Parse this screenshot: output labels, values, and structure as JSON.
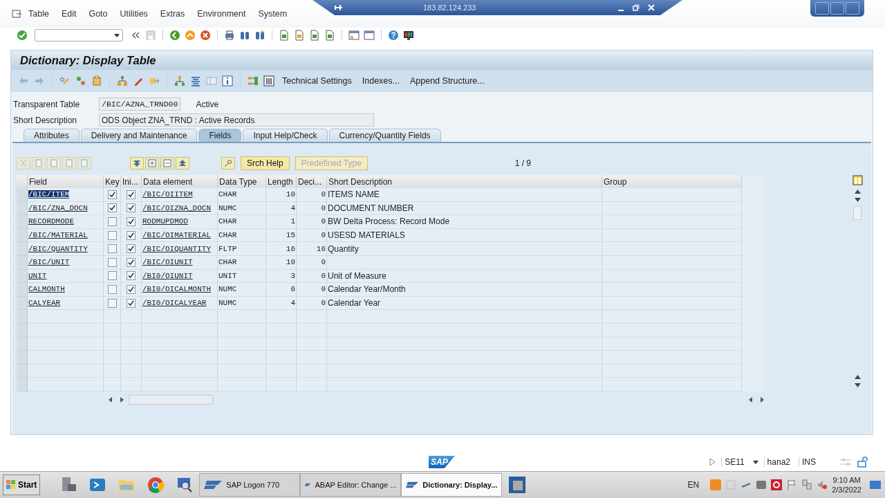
{
  "remote_bar": {
    "title": "183.82.124.233"
  },
  "menu": [
    "Table",
    "Edit",
    "Goto",
    "Utilities",
    "Extras",
    "Environment",
    "System"
  ],
  "screen_title": "Dictionary: Display Table",
  "app_toolbar": [
    "Technical Settings",
    "Indexes...",
    "Append Structure..."
  ],
  "header": {
    "type_label": "Transparent Table",
    "table_name": "/BIC/AZNA_TRND00",
    "status": "Active",
    "desc_label": "Short Description",
    "description": "ODS Object ZNA_TRND : Active Records"
  },
  "tabs": [
    {
      "label": "Attributes",
      "selected": false
    },
    {
      "label": "Delivery and Maintenance",
      "selected": false
    },
    {
      "label": "Fields",
      "selected": true
    },
    {
      "label": "Input Help/Check",
      "selected": false
    },
    {
      "label": "Currency/Quantity Fields",
      "selected": false
    }
  ],
  "table_buttons": [
    {
      "label": "Srch Help",
      "disabled": false
    },
    {
      "label": "Predefined Type",
      "disabled": true
    }
  ],
  "pager": "1 / 9",
  "table": {
    "columns": [
      "Field",
      "Key",
      "Ini...",
      "Data element",
      "Data Type",
      "Length",
      "Deci...",
      "Short Description",
      "Group"
    ],
    "rows": [
      {
        "field": "/BIC/ITEM",
        "selected": true,
        "key": true,
        "initial": true,
        "data_element": "/BIC/OIITEM",
        "data_type": "CHAR",
        "length": "10",
        "decimals": "0",
        "description": "ITEMS NAME"
      },
      {
        "field": "/BIC/ZNA_DOCN",
        "selected": false,
        "key": true,
        "initial": true,
        "data_element": "/BIC/OIZNA_DOCN",
        "data_type": "NUMC",
        "length": "4",
        "decimals": "0",
        "description": "DOCUMENT NUMBER"
      },
      {
        "field": "RECORDMODE",
        "selected": false,
        "key": false,
        "initial": true,
        "data_element": "RODMUPDMOD",
        "data_type": "CHAR",
        "length": "1",
        "decimals": "0",
        "description": "BW Delta Process: Record Mode"
      },
      {
        "field": "/BIC/MATERIAL",
        "selected": false,
        "key": false,
        "initial": true,
        "data_element": "/BIC/OIMATERIAL",
        "data_type": "CHAR",
        "length": "15",
        "decimals": "0",
        "description": "USESD MATERIALS"
      },
      {
        "field": "/BIC/QUANTITY",
        "selected": false,
        "key": false,
        "initial": true,
        "data_element": "/BIC/OIQUANTITY",
        "data_type": "FLTP",
        "length": "16",
        "decimals": "16",
        "description": "Quantity"
      },
      {
        "field": "/BIC/UNIT",
        "selected": false,
        "key": false,
        "initial": true,
        "data_element": "/BIC/OIUNIT",
        "data_type": "CHAR",
        "length": "10",
        "decimals": "0"
      },
      {
        "field": "UNIT",
        "selected": false,
        "key": false,
        "initial": true,
        "data_element": "/BI0/OIUNIT",
        "data_type": "UNIT",
        "length": "3",
        "decimals": "0",
        "description": "Unit of Measure"
      },
      {
        "field": "CALMONTH",
        "selected": false,
        "key": false,
        "initial": true,
        "data_element": "/BI0/OICALMONTH",
        "data_type": "NUMC",
        "length": "6",
        "decimals": "0",
        "description": "Calendar Year/Month"
      },
      {
        "field": "CALYEAR",
        "selected": false,
        "key": false,
        "initial": true,
        "data_element": "/BI0/OICALYEAR",
        "data_type": "NUMC",
        "length": "4",
        "decimals": "0",
        "description": "Calendar Year"
      }
    ]
  },
  "sap_logo": "SAP",
  "status_bar": {
    "transaction": "SE11",
    "system": "hana2",
    "mode": "INS"
  },
  "taskbar": {
    "start": "Start",
    "tasks": [
      {
        "label": "SAP Logon 770",
        "selected": false
      },
      {
        "label": "ABAP Editor: Change ...",
        "selected": false
      },
      {
        "label": "Dictionary: Display...",
        "selected": true
      }
    ],
    "language": "EN",
    "time": "9:10 AM",
    "date": "2/3/2022"
  }
}
